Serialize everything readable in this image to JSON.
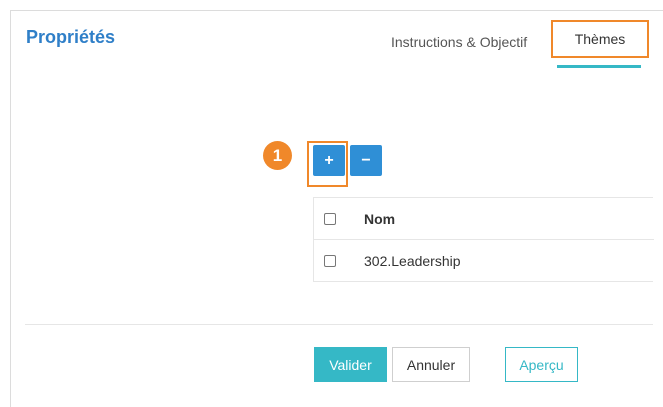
{
  "header": {
    "title": "Propriétés",
    "tabs": [
      {
        "label": "Instructions & Objectif",
        "active": false
      },
      {
        "label": "Thèmes",
        "active": true
      }
    ]
  },
  "annotation": {
    "step": "1"
  },
  "toolbar": {
    "add_label": "+",
    "remove_label": "−"
  },
  "table": {
    "columns": [
      "Nom"
    ],
    "rows": [
      {
        "name": "302.Leadership",
        "checked": false
      }
    ]
  },
  "footer": {
    "valider_label": "Valider",
    "annuler_label": "Annuler",
    "apercu_label": "Aperçu"
  },
  "colors": {
    "title": "#2f7fc8",
    "highlight": "#f0882a",
    "accent": "#35b8c6",
    "button_blue": "#2f8fd6"
  }
}
